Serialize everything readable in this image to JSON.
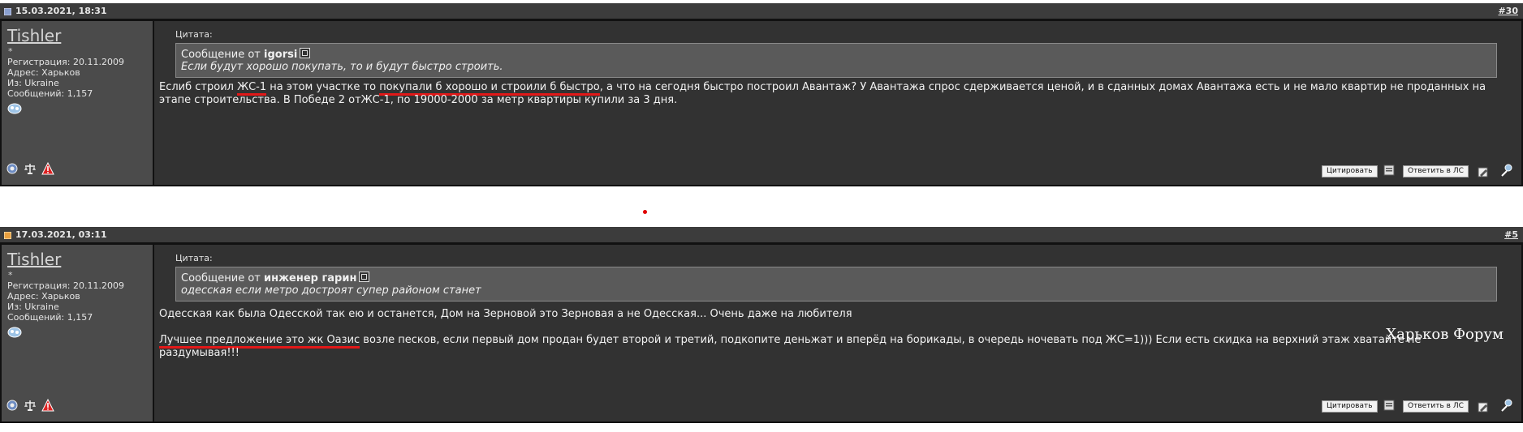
{
  "posts": [
    {
      "date": "15.03.2021, 18:31",
      "number": "#30",
      "user": {
        "name": "Tishler",
        "rank": "*",
        "registration": "Регистрация: 20.11.2009",
        "address": "Адрес: Харьков",
        "from": "Из: Ukraine",
        "messages": "Сообщений: 1,157"
      },
      "quote": {
        "label": "Цитата:",
        "from_prefix": "Сообщение от",
        "author": "igorsi",
        "text": "Если будут хорошо покупать, то и будут быстро строить."
      },
      "message": {
        "part1": "Еслиб строил ",
        "u1": "ЖС-1",
        "part2": " на этом участке то ",
        "u2": "покупали б хорошо и строили б быстро",
        "part3": ", а что на сегодня быстро построил Авантаж? У Авантажа спрос сдерживается ценой, и в сданных домах Авантажа есть и не мало квартир не проданных на этапе строительства. В Победе 2 отЖС-1, по 19000-2000 за метр квартиры купили за 3 дня."
      },
      "buttons": {
        "quote": "Цитировать",
        "pm": "Ответить в ЛС"
      }
    },
    {
      "date": "17.03.2021, 03:11",
      "number": "#5",
      "user": {
        "name": "Tishler",
        "rank": "*",
        "registration": "Регистрация: 20.11.2009",
        "address": "Адрес: Харьков",
        "from": "Из: Ukraine",
        "messages": "Сообщений: 1,157"
      },
      "quote": {
        "label": "Цитата:",
        "from_prefix": "Сообщение от",
        "author": "инженер гарин",
        "text": "одесская если метро достроят супер районом станет"
      },
      "message": {
        "line1": "Одесская как была Одесской так ею и останется, Дом на Зерновой это Зерновая а не Одесская... Очень даже на любителя",
        "u1": "Лучшее предложение это жк Оазис",
        "line2_rest": " возле песков, если первый дом продан будет второй и третий, подкопите деньжат и вперёд на борикады, в очередь ночевать под ЖС=1))) Если есть скидка на верхний этаж хватайте не раздумывая!!!"
      },
      "buttons": {
        "quote": "Цитировать",
        "pm": "Ответить в ЛС"
      }
    }
  ],
  "watermark": "Харьков Форум",
  "icons": {
    "post_icon": "post-status-icon",
    "user_offline": "user-status-icon",
    "profile": "profile-icon",
    "reputation": "scales-icon",
    "report": "warning-icon",
    "multiquote": "multiquote-icon",
    "thanks": "thanks-icon",
    "edit": "edit-icon"
  },
  "colors": {
    "post_bg": "#323232",
    "userbox_bg": "#4b4b4b",
    "underline": "#e21818"
  }
}
